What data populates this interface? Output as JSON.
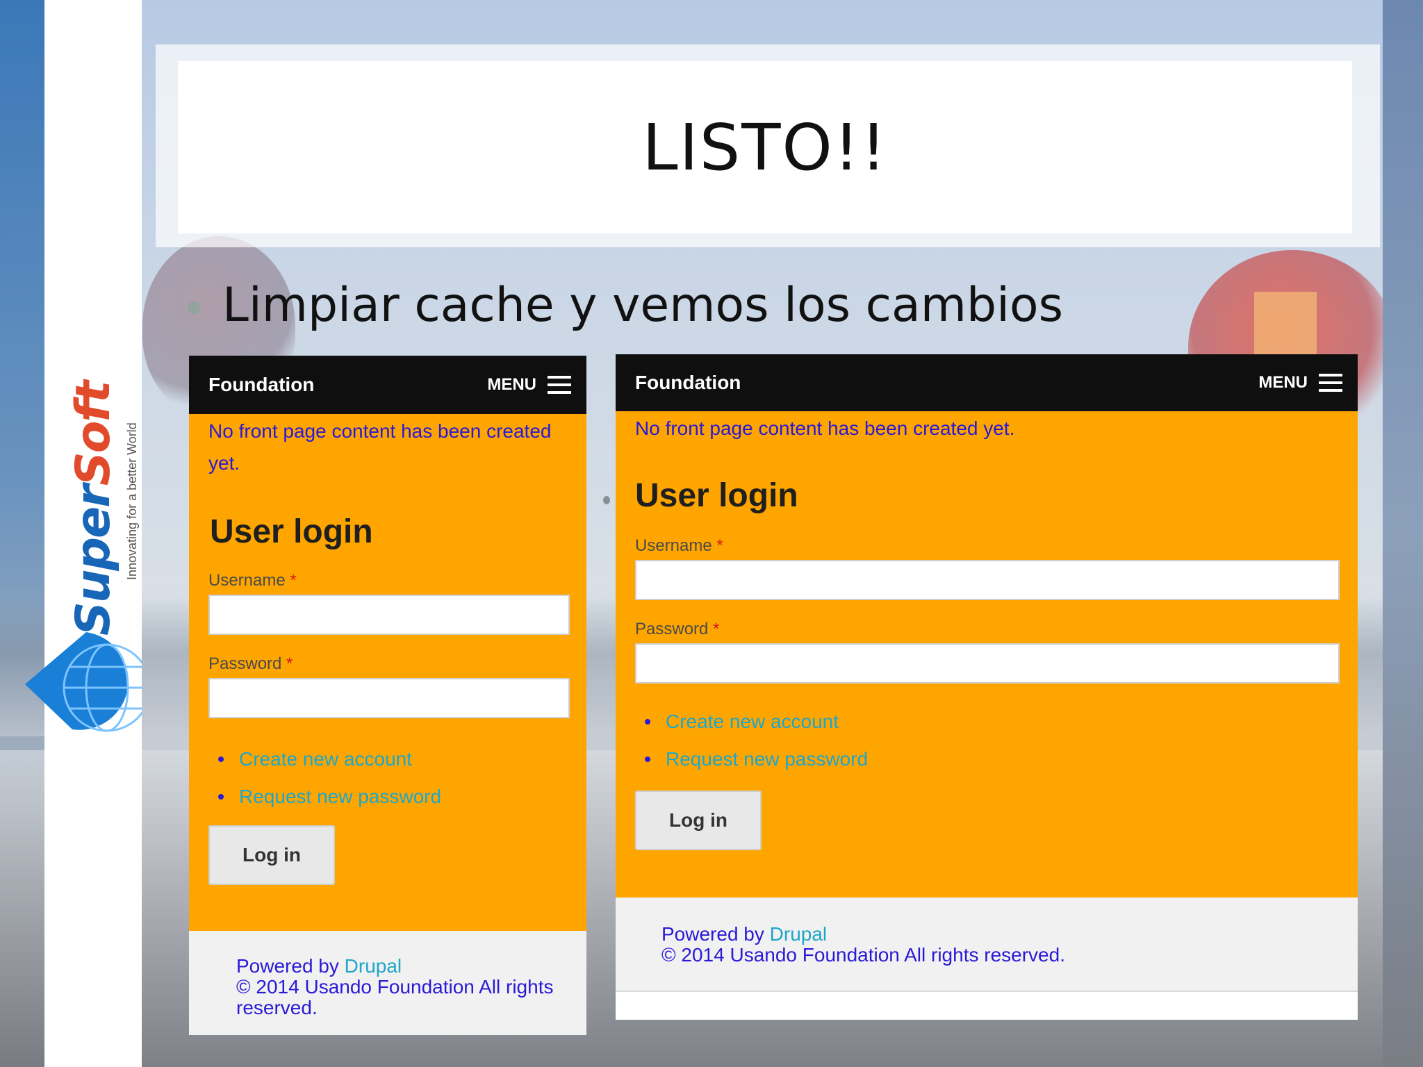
{
  "slide": {
    "title": "LISTO!!",
    "bullet": "Limpiar cache y vemos los cambios"
  },
  "logo": {
    "word_super": "Super",
    "word_soft": "Soft",
    "tagline": "Innovating for a better World"
  },
  "shot_left": {
    "brand": "Foundation",
    "menu_label": "MENU",
    "notice": "No front page content has been created yet.",
    "login_heading": "User login",
    "username_label": "Username",
    "password_label": "Password",
    "required_mark": "*",
    "links": [
      "Create new account",
      "Request new password"
    ],
    "login_button": "Log in",
    "footer_powered": "Powered by",
    "footer_drupal": "Drupal",
    "footer_copy": "© 2014 Usando Foundation All rights reserved."
  },
  "shot_right": {
    "brand": "Foundation",
    "menu_label": "MENU",
    "notice": "No front page content has been created yet.",
    "login_heading": "User login",
    "username_label": "Username",
    "password_label": "Password",
    "required_mark": "*",
    "links": [
      "Create new account",
      "Request new password"
    ],
    "login_button": "Log in",
    "footer_powered": "Powered by",
    "footer_drupal": "Drupal",
    "footer_copy": "© 2014 Usando Foundation All rights reserved."
  },
  "colors": {
    "accent_orange": "#ffa500",
    "topbar": "#0f0f10",
    "notice_text": "#2a19d6",
    "link": "#1ea6c9",
    "required": "#d41a1a"
  }
}
